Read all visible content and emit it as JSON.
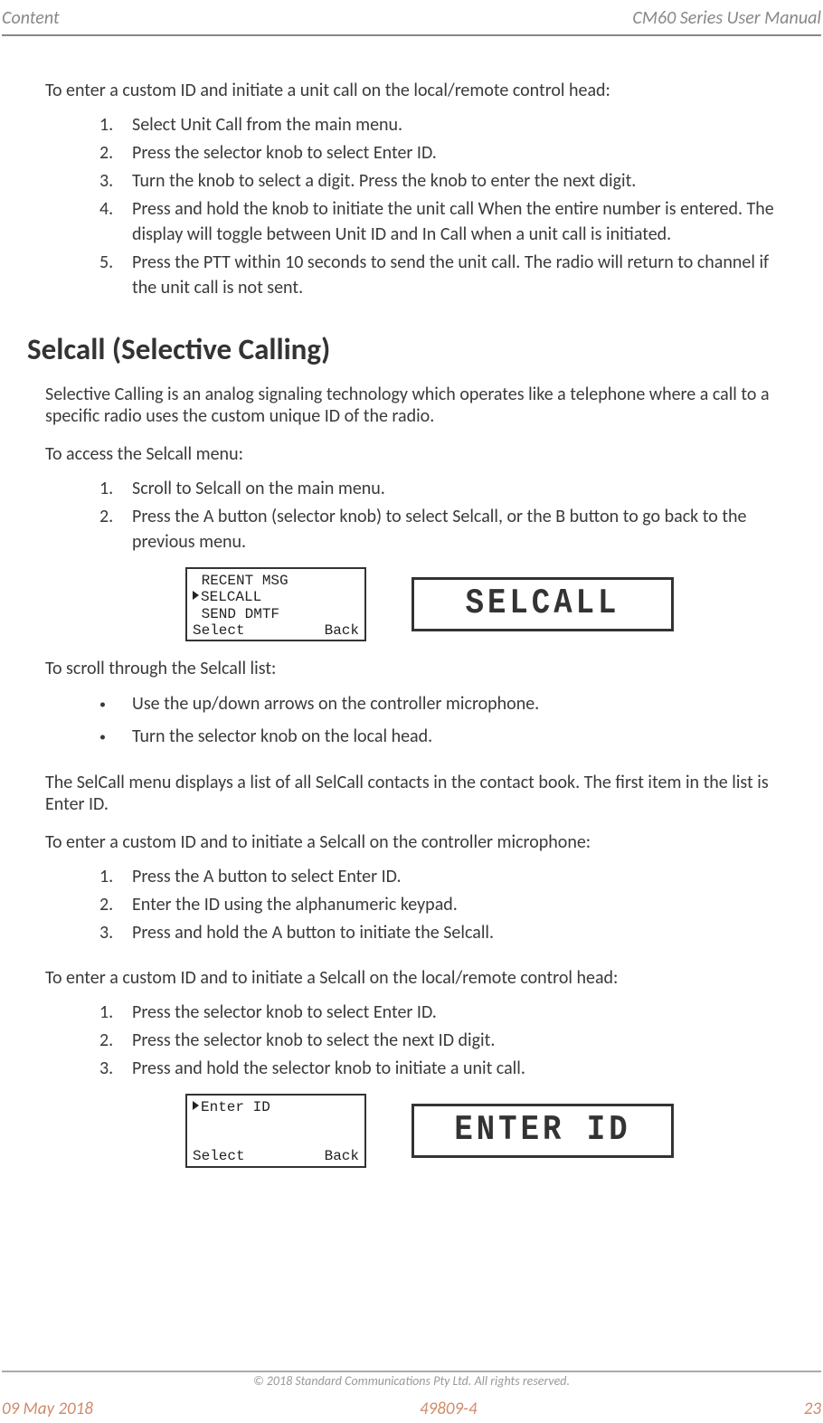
{
  "header": {
    "left": "Content",
    "right": "CM60 Series User Manual"
  },
  "p1": "To enter a custom ID and initiate a unit call on the local/remote control head:",
  "list1": [
    "Select Unit Call from the main menu.",
    "Press the selector knob to select Enter ID.",
    "Turn the knob to select a digit. Press the knob to enter the next digit.",
    "Press and hold the knob to initiate the unit call When the entire number is entered. The display will toggle between Unit ID and In Call when a unit call is initiated.",
    "Press the PTT within 10 seconds to send the unit call. The radio will return to channel if the unit call is not sent."
  ],
  "h2": "Selcall (Selective Calling)",
  "p2": "Selective Calling is an analog signaling technology which operates like a telephone where a call to a specific radio uses the custom unique ID of the radio.",
  "p3": "To access the Selcall menu:",
  "list2": [
    "Scroll to Selcall on the main menu.",
    "Press the A button (selector knob) to select Selcall, or the B button to go back to the previous menu."
  ],
  "screen1": {
    "row1": " RECENT MSG",
    "row2_sel": "SELCALL",
    "row3": " SEND DMTF",
    "left": "Select",
    "right": "Back",
    "seg": "SELCALL"
  },
  "p4": "To scroll through the Selcall list:",
  "blist": [
    "Use the up/down arrows on the controller microphone.",
    "Turn the selector knob on the local head."
  ],
  "p5": "The SelCall menu displays a list of all SelCall contacts in the contact book. The first item in the list is Enter ID.",
  "p6": "To enter a custom ID and to initiate a Selcall on the controller microphone:",
  "list3": [
    "Press the A button to select Enter ID.",
    "Enter the ID using the alphanumeric keypad.",
    "Press and hold the A button to initiate the Selcall."
  ],
  "p7": "To enter a custom ID and to initiate a Selcall on the local/remote control head:",
  "list4": [
    "Press the selector knob to select Enter ID.",
    "Press the selector knob to select the next ID digit.",
    "Press and hold the selector knob to initiate a unit call."
  ],
  "screen2": {
    "row1_sel": "Enter ID",
    "left": "Select",
    "right": "Back",
    "seg": "ENTER ID"
  },
  "copyright": "© 2018 Standard Communications Pty Ltd. All rights reserved.",
  "footer": {
    "left": "09 May 2018",
    "center": "49809-4",
    "right": "23"
  }
}
